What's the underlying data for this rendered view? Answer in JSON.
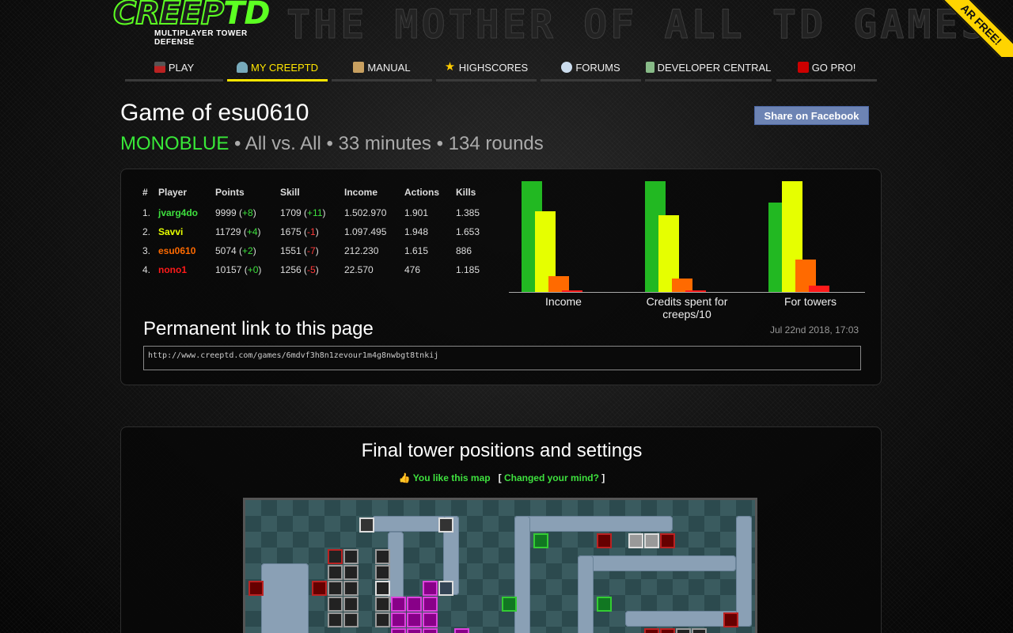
{
  "header": {
    "logo_text_creep": "CREEP",
    "logo_text_td": "TD",
    "logo_subtitle": "MULTIPLAYER TOWER DEFENSE",
    "tagline": "THE MOTHER OF ALL TD GAMES",
    "ribbon": "AR FREE!"
  },
  "nav": [
    {
      "label": "PLAY",
      "icon": "joystick-icon"
    },
    {
      "label": "MY CREEPTD",
      "icon": "user-icon",
      "active": true
    },
    {
      "label": "MANUAL",
      "icon": "book-icon"
    },
    {
      "label": "HIGHSCORES",
      "icon": "star-icon"
    },
    {
      "label": "FORUMS",
      "icon": "chat-bubbles-icon"
    },
    {
      "label": "DEVELOPER CENTRAL",
      "icon": "calculator-icon"
    },
    {
      "label": "GO PRO!",
      "icon": "pro-badge-icon"
    }
  ],
  "game": {
    "title": "Game of esu0610",
    "map_name": "MONOBLUE",
    "details": " • All vs. All • 33 minutes • 134 rounds",
    "share_label": "Share on Facebook"
  },
  "table": {
    "headers": [
      "#",
      "Player",
      "Points",
      "Skill",
      "Income",
      "Actions",
      "Kills"
    ],
    "rows": [
      {
        "rank": "1.",
        "player": "jvarg4do",
        "points": "9999",
        "points_delta": "+8",
        "skill": "1709",
        "skill_delta": "+11",
        "income": "1.502.970",
        "actions": "1.901",
        "kills": "1.385"
      },
      {
        "rank": "2.",
        "player": "Savvi",
        "points": "11729",
        "points_delta": "+4",
        "skill": "1675",
        "skill_delta": "-1",
        "income": "1.097.495",
        "actions": "1.948",
        "kills": "1.653"
      },
      {
        "rank": "3.",
        "player": "esu0610",
        "points": "5074",
        "points_delta": "+2",
        "skill": "1551",
        "skill_delta": "-7",
        "income": "212.230",
        "actions": "1.615",
        "kills": "886"
      },
      {
        "rank": "4.",
        "player": "nono1",
        "points": "10157",
        "points_delta": "+0",
        "skill": "1256",
        "skill_delta": "-5",
        "income": "22.570",
        "actions": "476",
        "kills": "1.185"
      }
    ]
  },
  "chart_data": {
    "type": "bar",
    "categories": [
      "Income",
      "Credits spent for creeps/10",
      "For towers"
    ],
    "series": [
      {
        "player": "jvarg4do",
        "color": "#22b822",
        "values": [
          100,
          100,
          81
        ]
      },
      {
        "player": "Savvi",
        "color": "#e6ff00",
        "values": [
          73,
          69,
          100
        ]
      },
      {
        "player": "esu0610",
        "color": "#ff6a00",
        "values": [
          14,
          12,
          29
        ]
      },
      {
        "player": "nono1",
        "color": "#ff1a1a",
        "values": [
          1.5,
          1,
          6
        ]
      }
    ],
    "ylim": [
      0,
      100
    ]
  },
  "permalink": {
    "heading": "Permanent link to this page",
    "date": "Jul 22nd 2018, 17:03",
    "url": "http://www.creeptd.com/games/6mdvf3h8n1zevour1m4g8nwbgt8tnkij"
  },
  "towers_section": {
    "heading": "Final tower positions and settings",
    "like_text": "You like this map",
    "changed_mind": "Changed your mind?",
    "bracket_open": "[",
    "bracket_close": "]"
  },
  "colors": {
    "accent_yellow": "#ffe600",
    "accent_green": "#38e838",
    "facebook": "#6d84b4"
  }
}
